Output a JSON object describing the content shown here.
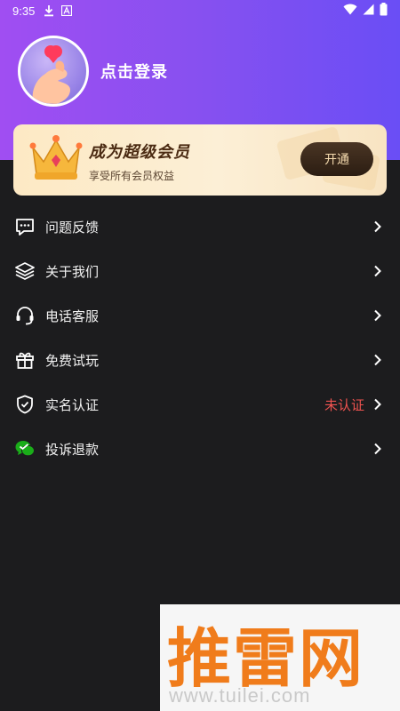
{
  "status_bar": {
    "time": "9:35",
    "icons": [
      "download-icon",
      "font-a-icon",
      "wifi-icon",
      "signal-icon",
      "battery-icon"
    ]
  },
  "profile": {
    "login_label": "点击登录"
  },
  "vip": {
    "title": "成为超级会员",
    "subtitle": "享受所有会员权益",
    "button_label": "开通"
  },
  "menu": {
    "items": [
      {
        "label": "问题反馈",
        "icon": "feedback-icon"
      },
      {
        "label": "关于我们",
        "icon": "layers-icon"
      },
      {
        "label": "电话客服",
        "icon": "headset-icon"
      },
      {
        "label": "免费试玩",
        "icon": "gift-icon"
      },
      {
        "label": "实名认证",
        "icon": "shield-check-icon",
        "status": "未认证"
      },
      {
        "label": "投诉退款",
        "icon": "wechat-icon"
      }
    ]
  },
  "watermark": {
    "text": "推雷网",
    "url": "www.tuilei.com"
  },
  "colors": {
    "header_gradient_start": "#a04ef2",
    "header_gradient_end": "#6a4ef5",
    "background": "#1c1c1e",
    "vip_card": "#fcefd6",
    "status_red": "#ef5350",
    "wechat_green": "#1aad19"
  }
}
